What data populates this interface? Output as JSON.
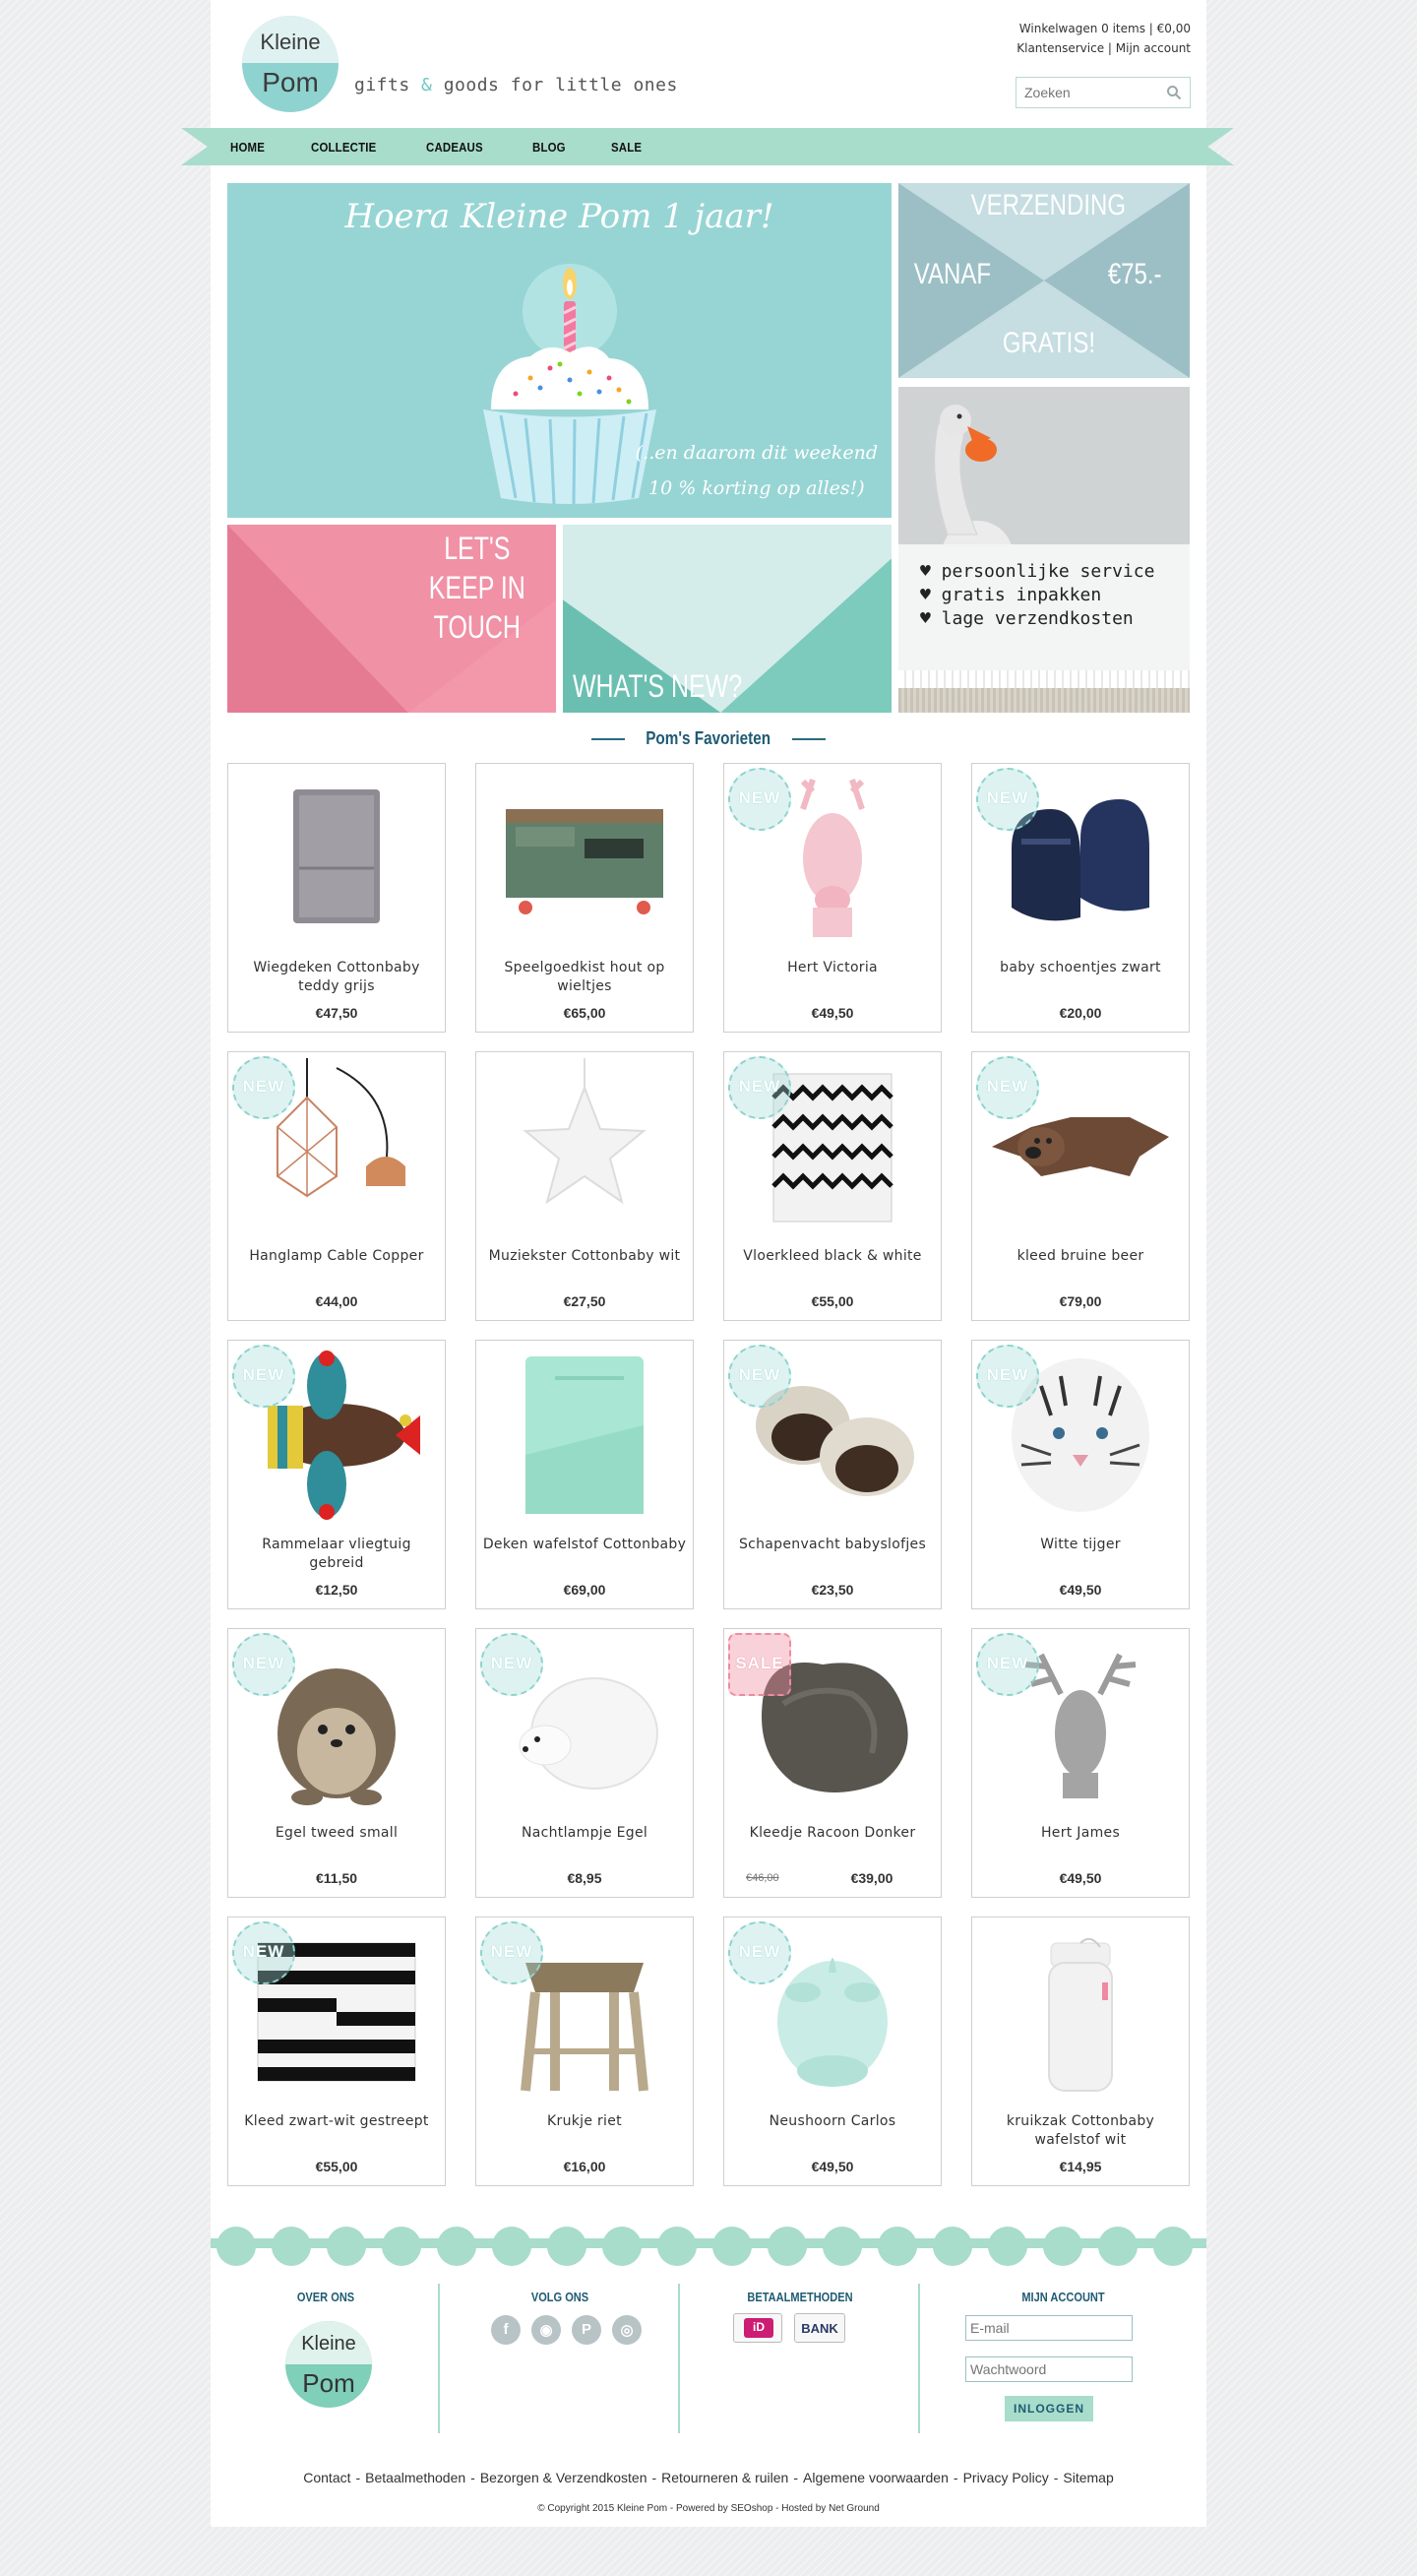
{
  "header": {
    "logo": {
      "line1": "Kleine",
      "line2": "Pom"
    },
    "tagline_part1": "gifts ",
    "tagline_amp": "&",
    "tagline_part2": " goods for little ones",
    "cart": "Winkelwagen 0 items | €0,00",
    "customer_service": "Klantenservice",
    "account_sep": " | ",
    "my_account": "Mijn account",
    "search_placeholder": "Zoeken"
  },
  "nav": {
    "items": [
      {
        "label": "HOME"
      },
      {
        "label": "COLLECTIE"
      },
      {
        "label": "CADEAUS"
      },
      {
        "label": "BLOG"
      },
      {
        "label": "SALE"
      }
    ]
  },
  "banners": {
    "birthday_title": "Hoera Kleine Pom 1 jaar!",
    "birthday_sub1": "(..en daarom dit weekend",
    "birthday_sub2": "10 % korting op alles!)",
    "shipping_top": "VERZENDING",
    "shipping_left": "VANAF",
    "shipping_right": "€75.-",
    "shipping_bottom": "GRATIS!",
    "touch": "LET'S KEEP IN TOUCH",
    "whats_new": "WHAT'S NEW?",
    "service": [
      "♥ persoonlijke service",
      "♥ gratis inpakken",
      "♥ lage verzendkosten"
    ]
  },
  "favorites_title": "Pom's Favorieten",
  "products": [
    {
      "name": "Wiegdeken Cottonbaby teddy grijs",
      "price": "€47,50",
      "badge": "",
      "icon": "blanket-grey"
    },
    {
      "name": "Speelgoedkist hout op wieltjes",
      "price": "€65,00",
      "badge": "",
      "icon": "wooden-chest"
    },
    {
      "name": "Hert Victoria",
      "price": "€49,50",
      "badge": "NEW",
      "icon": "pink-deer-head"
    },
    {
      "name": "baby schoentjes zwart",
      "price": "€20,00",
      "badge": "NEW",
      "icon": "baby-shoes"
    },
    {
      "name": "Hanglamp Cable Copper",
      "price": "€44,00",
      "badge": "NEW",
      "icon": "copper-lamp"
    },
    {
      "name": "Muziekster Cottonbaby wit",
      "price": "€27,50",
      "badge": "",
      "icon": "white-star"
    },
    {
      "name": "Vloerkleed black & white",
      "price": "€55,00",
      "badge": "NEW",
      "icon": "zigzag-rug"
    },
    {
      "name": "kleed bruine beer",
      "price": "€79,00",
      "badge": "NEW",
      "icon": "bear-rug"
    },
    {
      "name": "Rammelaar vliegtuig gebreid",
      "price": "€12,50",
      "badge": "NEW",
      "icon": "knitted-plane"
    },
    {
      "name": "Deken wafelstof Cottonbaby",
      "price": "€69,00",
      "badge": "",
      "icon": "mint-blanket"
    },
    {
      "name": "Schapenvacht babyslofjes",
      "price": "€23,50",
      "badge": "NEW",
      "icon": "sheepskin-slippers"
    },
    {
      "name": "Witte tijger",
      "price": "€49,50",
      "badge": "NEW",
      "icon": "white-tiger-head"
    },
    {
      "name": "Egel tweed small",
      "price": "€11,50",
      "badge": "NEW",
      "icon": "tweed-hedgehog"
    },
    {
      "name": "Nachtlampje Egel",
      "price": "€8,95",
      "badge": "NEW",
      "icon": "hedgehog-lamp"
    },
    {
      "name": "Kleedje Racoon Donker",
      "price": "€39,00",
      "old_price": "€46,00",
      "badge": "SALE",
      "icon": "fur-rug"
    },
    {
      "name": "Hert James",
      "price": "€49,50",
      "badge": "NEW",
      "icon": "grey-deer-head"
    },
    {
      "name": "Kleed zwart-wit gestreept",
      "price": "€55,00",
      "badge": "NEW",
      "icon": "striped-rug"
    },
    {
      "name": "Krukje riet",
      "price": "€16,00",
      "badge": "NEW",
      "icon": "rattan-stool"
    },
    {
      "name": "Neushoorn Carlos",
      "price": "€49,50",
      "badge": "NEW",
      "icon": "rhino-head"
    },
    {
      "name": "kruikzak Cottonbaby wafelstof wit",
      "price": "€14,95",
      "badge": "",
      "icon": "hot-water-bottle"
    }
  ],
  "footer": {
    "about_title": "OVER ONS",
    "follow_title": "VOLG ONS",
    "payment_title": "BETAALMETHODEN",
    "account_title": "MIJN ACCOUNT",
    "logo": {
      "line1": "Kleine",
      "line2": "Pom"
    },
    "social": [
      {
        "name": "facebook-icon",
        "glyph": "f"
      },
      {
        "name": "rss-icon",
        "glyph": "◉"
      },
      {
        "name": "pinterest-icon",
        "glyph": "P"
      },
      {
        "name": "instagram-icon",
        "glyph": "◎"
      }
    ],
    "payment": {
      "ideal": "iD",
      "bank": "BANK"
    },
    "email_placeholder": "E-mail",
    "password_placeholder": "Wachtwoord",
    "login_label": "INLOGGEN",
    "links": [
      "Contact",
      "Betaalmethoden",
      "Bezorgen & Verzendkosten",
      "Retourneren & ruilen",
      "Algemene voorwaarden",
      "Privacy Policy",
      "Sitemap"
    ],
    "link_separator": "-",
    "copyright": "© Copyright 2015 Kleine Pom - Powered by SEOshop - Hosted by Net Ground"
  },
  "colors": {
    "mint": "#a8dccb",
    "teal": "#97d5d4",
    "pink": "#f397ab",
    "heading_blue": "#1f5b73"
  }
}
